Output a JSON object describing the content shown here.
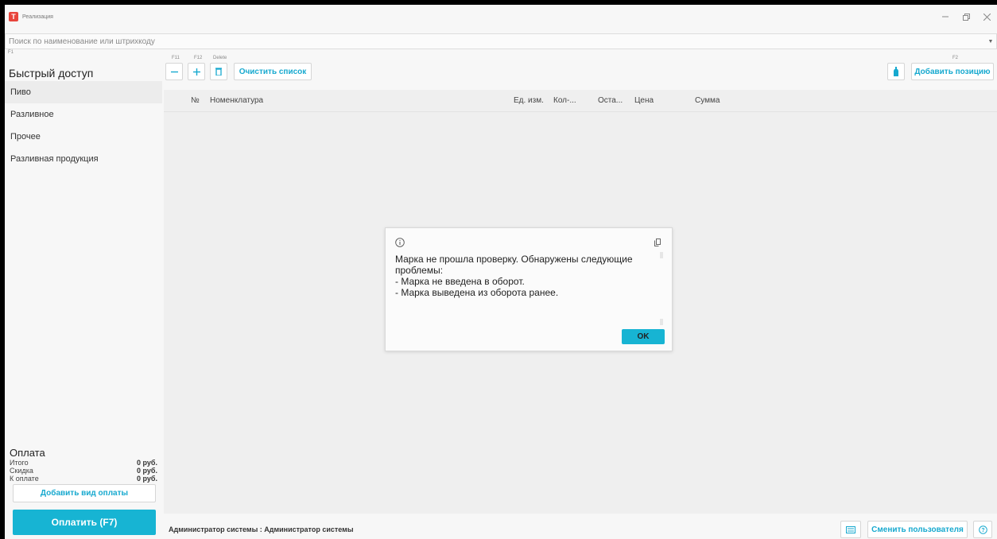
{
  "window": {
    "title": "Реализация",
    "logo_letter": "Т"
  },
  "search": {
    "placeholder": "Поиск по наименование или штрихкоду",
    "hotkey": "F1"
  },
  "toolbar": {
    "hotkey_minus": "F11",
    "hotkey_plus": "F12",
    "hotkey_delete": "Delete",
    "clear_label": "Очистить список",
    "add_hotkey": "F2",
    "add_label": "Добавить позицию"
  },
  "sidebar": {
    "title": "Быстрый доступ",
    "items": [
      {
        "label": "Пиво"
      },
      {
        "label": "Разливное"
      },
      {
        "label": "Прочее"
      },
      {
        "label": "Разливная продукция"
      }
    ]
  },
  "payment": {
    "title": "Оплата",
    "rows": [
      {
        "label": "Итого",
        "value": "0 руб."
      },
      {
        "label": "Скидка",
        "value": "0 руб."
      },
      {
        "label": "К оплате",
        "value": "0 руб."
      }
    ],
    "add_label": "Добавить вид оплаты",
    "pay_label": "Оплатить (F7)"
  },
  "table": {
    "columns": [
      "№",
      "Номенклатура",
      "Ед. изм.",
      "Кол-...",
      "Оста...",
      "Цена",
      "Сумма"
    ]
  },
  "status": {
    "user": "Администратор системы : Администратор системы",
    "change_user_label": "Сменить пользователя"
  },
  "dialog": {
    "message": "Марка не прошла проверку. Обнаружены следующие проблемы:\n - Марка не введена в оборот.\n - Марка выведена из оборота ранее.",
    "ok_label": "OK"
  },
  "colors": {
    "accent": "#17b4d3",
    "accent_text": "#17a9cf",
    "logo": "#e8453c"
  }
}
